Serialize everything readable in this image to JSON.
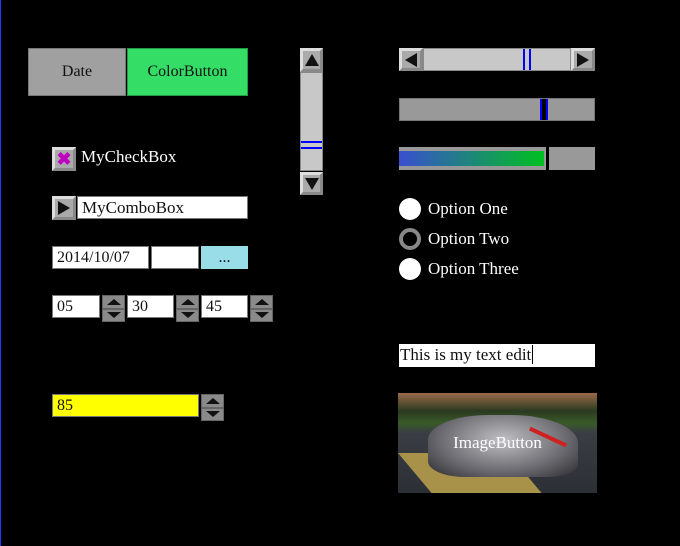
{
  "buttons": {
    "date": "Date",
    "color": "ColorButton"
  },
  "checkbox": {
    "label": "MyCheckBox",
    "checked": true
  },
  "combo": {
    "value": "MyComboBox"
  },
  "date_picker": {
    "value": "2014/10/07",
    "extra": "",
    "browse": "..."
  },
  "time": {
    "hour": "05",
    "minute": "30",
    "second": "45"
  },
  "spinbox": {
    "value": "85"
  },
  "radios": [
    {
      "label": "Option One",
      "selected": false
    },
    {
      "label": "Option Two",
      "selected": true
    },
    {
      "label": "Option Three",
      "selected": false
    }
  ],
  "text_edit": {
    "value": "This is my text edit"
  },
  "image_button": {
    "label": "ImageButton"
  },
  "progress": {
    "value_percent": 75
  },
  "slider": {
    "value_percent": 75
  },
  "hscroll": {
    "value_percent": 72
  },
  "vscroll": {
    "value_percent": 72
  },
  "colors": {
    "color_button": "#33dd66",
    "date_browse": "#99dde8",
    "spin_field": "#ffff00",
    "thumb": "#0000ff"
  }
}
